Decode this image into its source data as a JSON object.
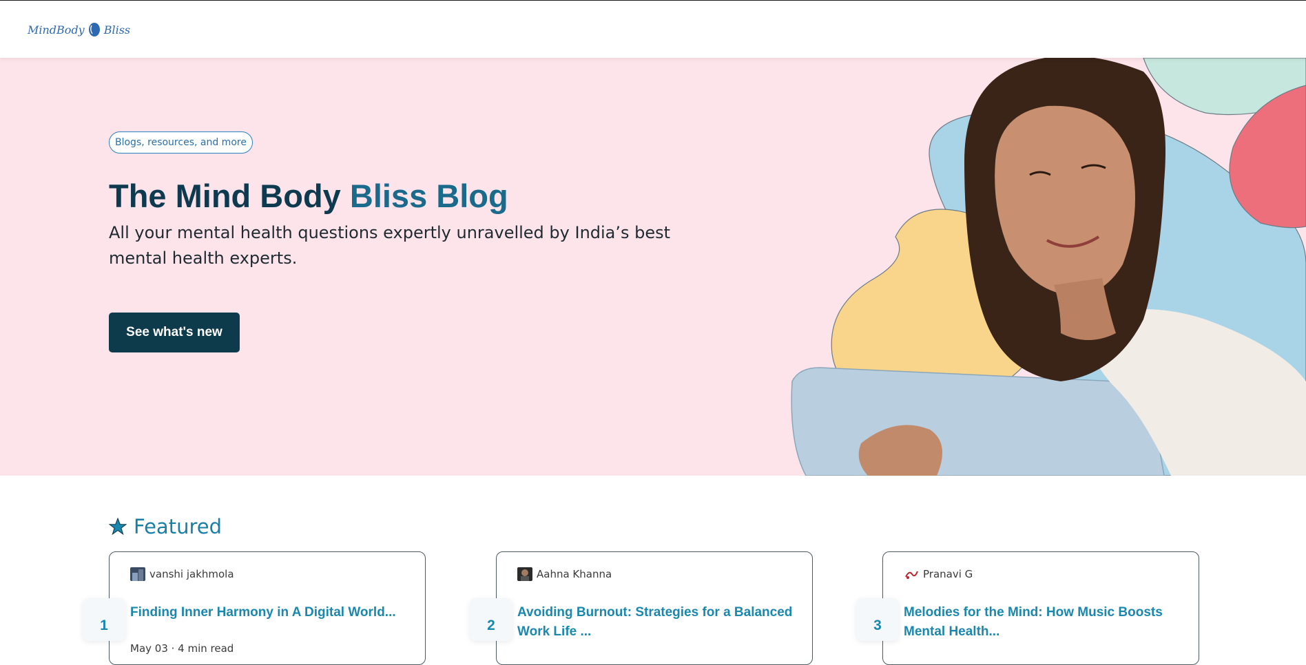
{
  "header": {
    "logo_text_left": "MindBody",
    "logo_text_right": "Bliss"
  },
  "hero": {
    "pill": "Blogs, resources, and more",
    "title_main": "The Mind Body ",
    "title_accent": "Bliss Blog",
    "subtitle": "All your mental health questions expertly unravelled by India’s best mental health experts.",
    "cta_label": "See what's new"
  },
  "featured": {
    "heading": "Featured",
    "cards": [
      {
        "rank": "1",
        "author": "vanshi jakhmola",
        "title": "Finding Inner Harmony in A Digital World...",
        "meta": "May 03  ·  4 min read"
      },
      {
        "rank": "2",
        "author": "Aahna Khanna",
        "title": "Avoiding Burnout: Strategies for a Balanced Work Life ...",
        "meta": ""
      },
      {
        "rank": "3",
        "author": "Pranavi G",
        "title": "Melodies for the Mind: How Music Boosts Mental Health...",
        "meta": ""
      }
    ]
  },
  "colors": {
    "hero_bg": "#fde4eb",
    "primary_dark": "#0d3b4c",
    "accent_blue": "#1a87ae",
    "blob_yellow": "#f8d58a",
    "blob_blue": "#a9d3e6",
    "blob_coral": "#ee6f7c",
    "blob_mint": "#c6e7dd"
  },
  "icons": {
    "featured": "star-icon",
    "logo": "face-profile-icon"
  }
}
